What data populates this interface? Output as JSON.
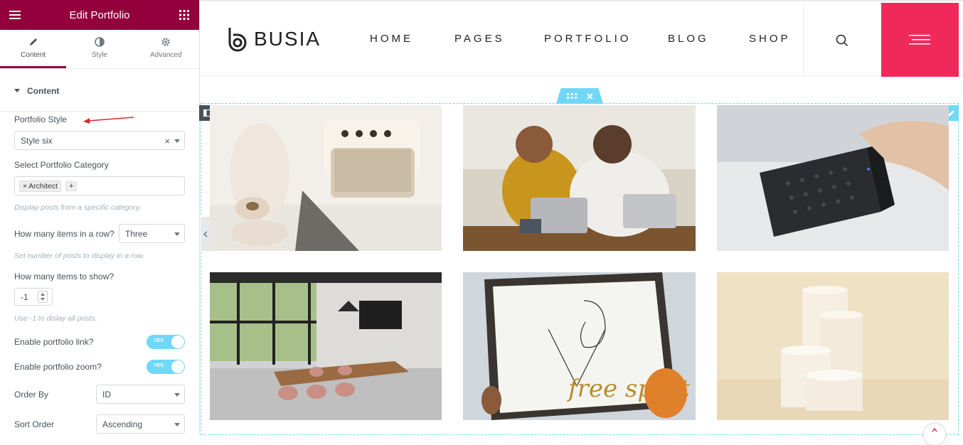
{
  "panel": {
    "title": "Edit Portfolio",
    "tabs": [
      {
        "label": "Content",
        "icon": "pencil-icon"
      },
      {
        "label": "Style",
        "icon": "contrast-icon"
      },
      {
        "label": "Advanced",
        "icon": "gear-icon"
      }
    ],
    "section": "Content",
    "portfolio_style": {
      "label": "Portfolio Style",
      "value": "Style six",
      "clear": "×"
    },
    "category": {
      "label": "Select Portfolio Category",
      "tag": "Architect",
      "tag_remove": "×",
      "add": "+",
      "desc": "Display posts from a specific category."
    },
    "items_row": {
      "label": "How many items in a row?",
      "value": "Three",
      "desc": "Set number of posts to display in a row."
    },
    "items_show": {
      "label": "How many items to show?",
      "value": "-1",
      "desc": "Use -1 to dislay all posts."
    },
    "link": {
      "label": "Enable portfolio link?",
      "state": "YES"
    },
    "zoom": {
      "label": "Enable portfolio zoom?",
      "state": "YES"
    },
    "order_by": {
      "label": "Order By",
      "value": "ID"
    },
    "sort_order": {
      "label": "Sort Order",
      "value": "Ascending"
    }
  },
  "site": {
    "logo": "BUSIA",
    "nav": [
      "HOME",
      "PAGES",
      "PORTFOLIO",
      "BLOG",
      "SHOP"
    ],
    "poster_text": "free spirit"
  },
  "colors": {
    "panel_header": "#93003c",
    "accent": "#ef2a5b",
    "editor_blue": "#71d7f7"
  }
}
